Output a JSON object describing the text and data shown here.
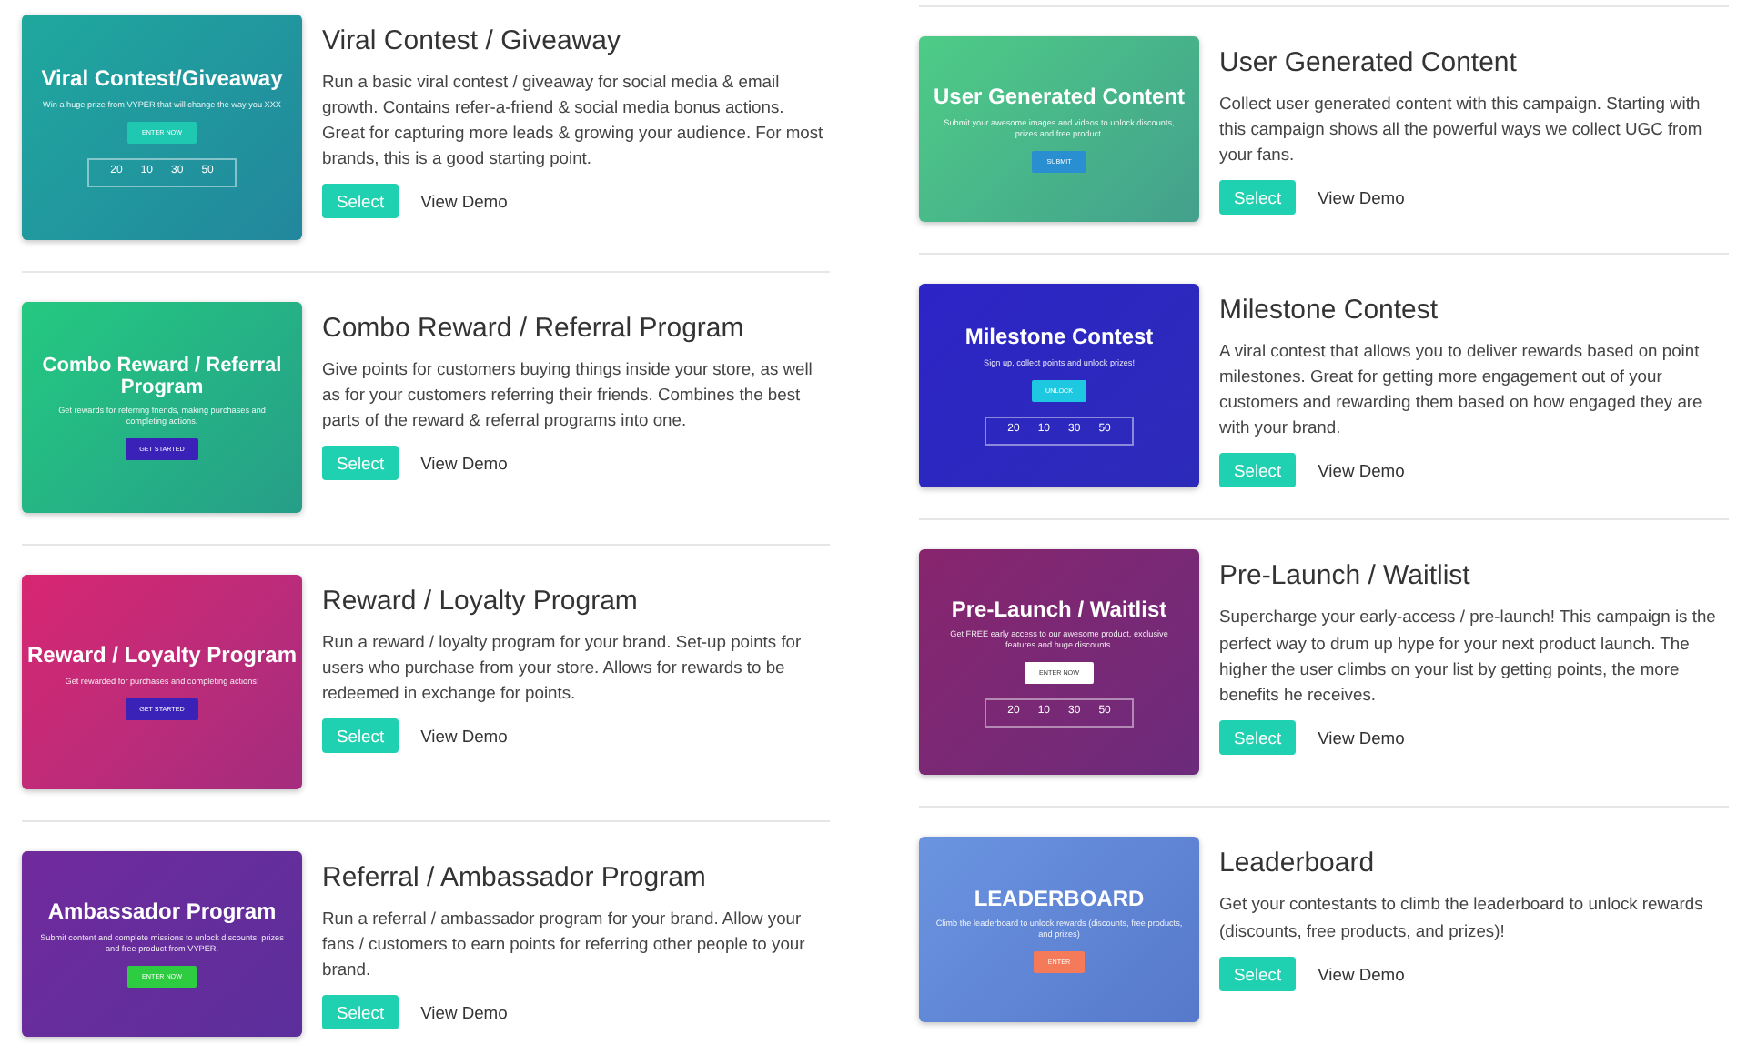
{
  "columns": [
    {
      "items": [
        {
          "title": "Viral Contest / Giveaway",
          "description": "Run a basic viral contest / giveaway for social media & email growth. Contains refer-a-friend & social media bonus actions. Great for capturing more leads & growing your audience. For most brands, this is a good starting point.",
          "select": "Select",
          "demo": "View Demo",
          "preview": {
            "color": "#1fa89e",
            "title": "Viral Contest/Giveaway",
            "subtitle": "Win a huge prize from VYPER that will change the way you XXX",
            "button": {
              "label": "ENTER NOW",
              "color": "#1fc8b0"
            },
            "countdown": [
              "20",
              "10",
              "30",
              "50"
            ]
          }
        },
        {
          "title": "Combo Reward / Referral Program",
          "description": "Give points for customers buying things inside your store, as well as for your customers referring their friends. Combines the best parts of the reward & referral programs into one.",
          "select": "Select",
          "demo": "View Demo",
          "preview": {
            "color": "#24c980",
            "title": "Combo Reward / Referral Program",
            "subtitle": "Get rewards for referring friends, making purchases and completing actions.",
            "button": {
              "label": "GET STARTED",
              "color": "#3a22b8"
            }
          }
        },
        {
          "title": "Reward / Loyalty Program",
          "description": "Run a reward / loyalty program for your brand. Set-up points for users who purchase from your store. Allows for rewards to be redeemed in exchange for points.",
          "select": "Select",
          "demo": "View Demo",
          "preview": {
            "color": "#d82672",
            "title": "Reward / Loyalty Program",
            "subtitle": "Get rewarded for purchases and completing actions!",
            "button": {
              "label": "GET STARTED",
              "color": "#3a22b8"
            }
          }
        },
        {
          "title": "Referral / Ambassador Program",
          "description": "Run a referral / ambassador program for your brand. Allow your fans / customers to earn points for referring other people to your brand.",
          "select": "Select",
          "demo": "View Demo",
          "preview": {
            "color": "#702a9c",
            "title": "Ambassador Program",
            "subtitle": "Submit content and complete missions to unlock discounts, prizes and free product from VYPER.",
            "button": {
              "label": "ENTER NOW",
              "color": "#2ecc40"
            }
          }
        }
      ]
    },
    {
      "items": [
        {
          "title": "User Generated Content",
          "description": "Collect user generated content with this campaign. Starting with this campaign shows all the powerful ways we collect UGC from your fans.",
          "select": "Select",
          "demo": "View Demo",
          "preview": {
            "color": "#4ecc86",
            "title": "User Generated Content",
            "subtitle": "Submit your awesome images and videos to unlock discounts, prizes and free product.",
            "button": {
              "label": "SUBMIT",
              "color": "#2a8fd0"
            }
          }
        },
        {
          "title": "Milestone Contest",
          "description": "A viral contest that allows you to deliver rewards based on point milestones. Great for getting more engagement out of your customers and rewarding them based on how engaged they are with your brand.",
          "select": "Select",
          "demo": "View Demo",
          "preview": {
            "color": "#2d24c6",
            "title": "Milestone Contest",
            "subtitle": "Sign up, collect points and unlock prizes!",
            "button": {
              "label": "UNLOCK",
              "color": "#1ec8e0"
            },
            "countdown": [
              "20",
              "10",
              "30",
              "50"
            ]
          }
        },
        {
          "title": "Pre-Launch / Waitlist",
          "description": "Supercharge your early-access / pre-launch! This campaign is the perfect way to drum up hype for your next product launch. The higher the user climbs on your list by getting points, the more benefits he receives.",
          "select": "Select",
          "demo": "View Demo",
          "preview": {
            "color": "#88246e",
            "title": "Pre-Launch / Waitlist",
            "subtitle": "Get FREE early access to our awesome product, exclusive features and huge discounts.",
            "button": {
              "label": "ENTER NOW",
              "color": "#ffffff"
            },
            "countdown": [
              "20",
              "10",
              "30",
              "50"
            ]
          }
        },
        {
          "title": "Leaderboard",
          "description": "Get your contestants to climb the leaderboard to unlock rewards (discounts, free products, and prizes)!",
          "select": "Select",
          "demo": "View Demo",
          "preview": {
            "color": "#6a94e0",
            "title": "LEADERBOARD",
            "subtitle": "Climb the leaderboard to unlock rewards (discounts, free products, and prizes)",
            "button": {
              "label": "ENTER",
              "color": "#f47a5a"
            }
          }
        }
      ]
    }
  ]
}
